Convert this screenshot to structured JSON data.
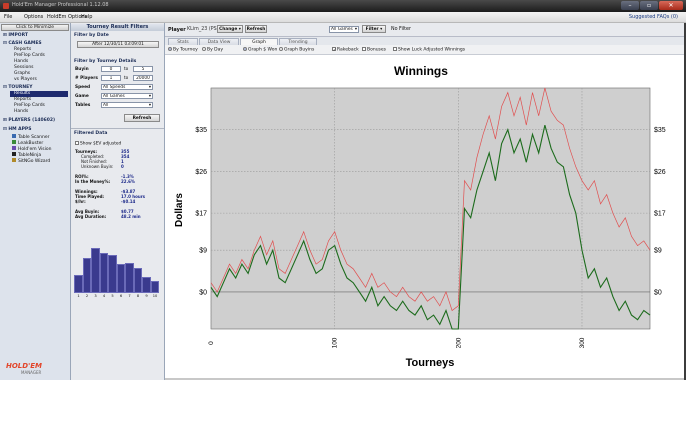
{
  "titlebar": {
    "title": "Hold'Em Manager Professional 1.12.08"
  },
  "menu": {
    "items": [
      "File",
      "Options",
      "HoldEm Options",
      "Help"
    ],
    "suggested": "Suggested FAQs (0)"
  },
  "nav": {
    "minimize_label": "Click to Minimize",
    "import": "IMPORT",
    "cash_games": "CASH GAMES",
    "cash_items": [
      "Reports",
      "PreFlop Cards",
      "Hands",
      "Sessions",
      "Graphs",
      "vs Players"
    ],
    "tourney": "TOURNEY",
    "tourney_items": [
      "Results",
      "Reports",
      "PreFlop Cards",
      "Hands"
    ],
    "players": "PLAYERS (140602)",
    "hm_apps": "HM APPS",
    "apps": [
      "Table Scanner",
      "LeakBuster",
      "Hold'em Vision",
      "TableNinja",
      "SitNGo Wizard"
    ],
    "logo": "HOLD'EM",
    "logo_sub": "MANAGER"
  },
  "filters": {
    "header": "Tourney Result Filters",
    "by_date": "Filter by Date",
    "date_button": "After 12/30/11 03:09:01",
    "by_details": "Filter by Tourney Details",
    "buyin_label": "Buyin",
    "buyin_from": "0",
    "buyin_to": "5",
    "players_label": "# Players",
    "players_from": "1",
    "players_to": "20000",
    "to": "to",
    "speed_label": "Speed",
    "speed_value": "All Speeds",
    "game_label": "Game",
    "game_value": "All Games",
    "tables_label": "Tables",
    "tables_value": "All",
    "refresh": "Refresh",
    "filtered_data": "Filtered Data",
    "show_sev": "Show $EV adjusted",
    "stats": [
      {
        "label": "Tourneys:",
        "value": "355"
      },
      {
        "label": "Completed:",
        "value": "354"
      },
      {
        "label": "Not Finished:",
        "value": "1"
      },
      {
        "label": "Unknown Buyin:",
        "value": "0"
      },
      {
        "label": "ROI%:",
        "value": "-1.3%"
      },
      {
        "label": "In the Money%:",
        "value": "22.6%"
      },
      {
        "label": "Winnings:",
        "value": "-$3.87"
      },
      {
        "label": "Time Played:",
        "value": "17.0 hours"
      },
      {
        "label": "$/hr:",
        "value": "-$0.14"
      },
      {
        "label": "Avg Buyin:",
        "value": "$0.77"
      },
      {
        "label": "Avg Duration:",
        "value": "48.2 min"
      }
    ],
    "histogram_labels": [
      "1",
      "2",
      "3",
      "4",
      "5",
      "6",
      "7",
      "8",
      "9",
      "10"
    ],
    "histogram_values": [
      13,
      26,
      33,
      29,
      28,
      21,
      22,
      18,
      12,
      9
    ]
  },
  "topbar": {
    "player_label": "Player",
    "player_value": "KLim_23 (PS)",
    "change": "Change",
    "refresh": "Refresh",
    "games_value": "All Games",
    "filter_btn": "Filter",
    "no_filter": "No Filter"
  },
  "tabs": [
    {
      "label": "Stats",
      "active": false
    },
    {
      "label": "Data View",
      "active": false
    },
    {
      "label": "Graph",
      "active": true
    },
    {
      "label": "Trending",
      "active": false
    }
  ],
  "options": {
    "by_tourney": "By Tourney",
    "by_day": "By Day",
    "graph_view": "Graph $ Won",
    "graph_buyins": "Graph Buyins",
    "rakeback": "Rakeback",
    "bonuses": "Bonuses",
    "luck_adjusted": "Show Luck Adjusted Winnings"
  },
  "chart_data": {
    "type": "line",
    "title": "Winnings",
    "xlabel": "Tourneys",
    "ylabel": "Dollars",
    "xlim": [
      0,
      355
    ],
    "ylim": [
      -8,
      44
    ],
    "xticks": [
      0,
      100,
      200,
      300
    ],
    "yticks": [
      0,
      9,
      17,
      26,
      35
    ],
    "ytick_labels": [
      "$0",
      "$9",
      "$17",
      "$26",
      "$35"
    ],
    "grid": true,
    "series": [
      {
        "name": "",
        "color": "#1c6b1c",
        "x": [
          0,
          5,
          10,
          15,
          20,
          25,
          30,
          35,
          40,
          45,
          50,
          55,
          60,
          65,
          70,
          75,
          80,
          85,
          90,
          95,
          100,
          105,
          110,
          115,
          120,
          125,
          130,
          135,
          140,
          145,
          150,
          155,
          160,
          165,
          170,
          175,
          180,
          185,
          190,
          195,
          200,
          205,
          210,
          215,
          220,
          225,
          230,
          235,
          240,
          245,
          250,
          255,
          260,
          265,
          270,
          275,
          280,
          285,
          290,
          295,
          300,
          305,
          310,
          315,
          320,
          325,
          330,
          335,
          340,
          345,
          350,
          355
        ],
        "y": [
          1,
          -1,
          2,
          5,
          3,
          6,
          4,
          8,
          10,
          6,
          9,
          3,
          2,
          5,
          8,
          11,
          7,
          4,
          5,
          9,
          10,
          6,
          3,
          2,
          0,
          -2,
          1,
          -3,
          -1,
          -3,
          -4,
          -2,
          -4,
          -5,
          -3,
          -6,
          -5,
          -7,
          -4,
          -8,
          -8,
          18,
          16,
          22,
          26,
          30,
          24,
          32,
          35,
          30,
          33,
          28,
          34,
          30,
          36,
          31,
          28,
          27,
          21,
          17,
          9,
          3,
          5,
          1,
          3,
          -1,
          -4,
          -2,
          -5,
          -6,
          -4,
          -5
        ]
      },
      {
        "name": "",
        "color": "#e05050",
        "x": [
          0,
          5,
          10,
          15,
          20,
          25,
          30,
          35,
          40,
          45,
          50,
          55,
          60,
          65,
          70,
          75,
          80,
          85,
          90,
          95,
          100,
          105,
          110,
          115,
          120,
          125,
          130,
          135,
          140,
          145,
          150,
          155,
          160,
          165,
          170,
          175,
          180,
          185,
          190,
          195,
          200,
          205,
          210,
          215,
          220,
          225,
          230,
          235,
          240,
          245,
          250,
          255,
          260,
          265,
          270,
          275,
          280,
          285,
          290,
          295,
          300,
          305,
          310,
          315,
          320,
          325,
          330,
          335,
          340,
          345,
          350,
          355
        ],
        "y": [
          2,
          0,
          3,
          6,
          4,
          7,
          5,
          9,
          12,
          8,
          11,
          5,
          4,
          7,
          10,
          13,
          9,
          6,
          7,
          11,
          13,
          9,
          6,
          5,
          3,
          1,
          4,
          1,
          2,
          0,
          -1,
          1,
          -1,
          -2,
          0,
          -2,
          -1,
          -3,
          0,
          -4,
          -3,
          24,
          22,
          29,
          34,
          38,
          33,
          40,
          43,
          38,
          42,
          36,
          43,
          38,
          44,
          39,
          37,
          36,
          31,
          27,
          24,
          22,
          24,
          19,
          21,
          17,
          14,
          16,
          12,
          10,
          11,
          9
        ]
      }
    ]
  }
}
